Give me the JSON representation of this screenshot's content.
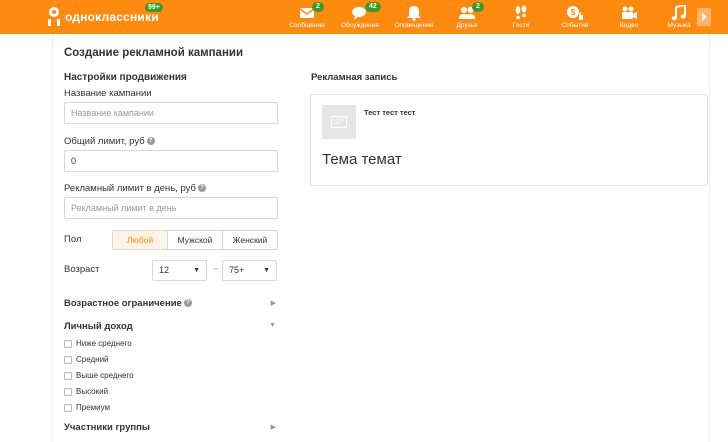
{
  "topbar": {
    "logo_text": "одноклассники",
    "logo_badge": "99+",
    "nav": [
      {
        "icon": "envelope-icon",
        "label": "Сообщения",
        "badge": "2"
      },
      {
        "icon": "chat-bubbles-icon",
        "label": "Обсуждения",
        "badge": "42"
      },
      {
        "icon": "bell-icon",
        "label": "Оповещения",
        "badge": ""
      },
      {
        "icon": "people-icon",
        "label": "Друзья",
        "badge": "2"
      },
      {
        "icon": "footprints-icon",
        "label": "Гости",
        "badge": ""
      },
      {
        "icon": "coins-like-icon",
        "label": "События",
        "badge": ""
      },
      {
        "icon": "video-camera-icon",
        "label": "Видео",
        "badge": ""
      },
      {
        "icon": "music-note-icon",
        "label": "Музыка",
        "badge": ""
      }
    ]
  },
  "page": {
    "title": "Создание рекламной кампании",
    "settings_title": "Настройки продвижения",
    "campaign_name": {
      "label": "Название кампании",
      "placeholder": "Название кампании",
      "value": ""
    },
    "total_limit": {
      "label": "Общий лимит, руб",
      "value": "0"
    },
    "daily_limit": {
      "label": "Рекламный лимит в день, руб",
      "placeholder": "Рекламный лимит в день",
      "value": ""
    },
    "gender": {
      "label": "Пол",
      "options": [
        "Любой",
        "Мужской",
        "Женский"
      ],
      "selected": "Любой"
    },
    "age": {
      "label": "Возраст",
      "from": "12",
      "to": "75+",
      "separator": "–"
    },
    "age_restriction": "Возрастное ограничение",
    "income": {
      "title": "Личный доход",
      "options": [
        "Ниже среднего",
        "Средний",
        "Выше среднего",
        "Высокий",
        "Премиум"
      ]
    },
    "group_members": "Участники группы"
  },
  "preview": {
    "title": "Рекламная запись",
    "name": "Тест тест тест",
    "headline": "Тема темат"
  },
  "colors": {
    "brand": "#ff8a10",
    "badge": "#3c9b27"
  }
}
